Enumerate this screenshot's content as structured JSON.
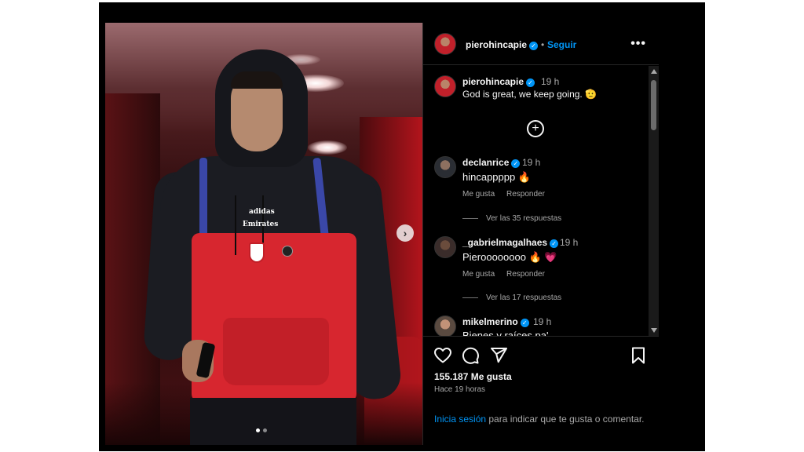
{
  "header": {
    "username": "pierohincapie",
    "verified": true,
    "separator": "•",
    "follow_label": "Seguir",
    "more_icon": "more-horizontal-icon"
  },
  "caption": {
    "username": "pierohincapie",
    "time": "19 h",
    "text": "God is great, we keep going. 🫡"
  },
  "load_more_icon": "plus-circle-icon",
  "comments": [
    {
      "username": "declanrice",
      "time": "19 h",
      "text": "hincappppp 🔥",
      "like_label": "Me gusta",
      "reply_label": "Responder",
      "view_replies": "Ver las 35 respuestas"
    },
    {
      "username": "_gabrielmagalhaes",
      "time": "19 h",
      "text": "Pieroooooooo 🔥 💗",
      "like_label": "Me gusta",
      "reply_label": "Responder",
      "view_replies": "Ver las 17 respuestas"
    },
    {
      "username": "mikelmerino",
      "time": "19 h",
      "text": "Bienes y raíces pa'"
    }
  ],
  "photo_text": {
    "brand": "adidas",
    "sponsor": "Emirates"
  },
  "footer": {
    "like_icon": "heart-icon",
    "comment_icon": "comment-icon",
    "share_icon": "send-icon",
    "save_icon": "bookmark-icon",
    "likes": "155.187 Me gusta",
    "posted": "Hace 19 horas",
    "login_link": "Inicia sesión",
    "login_text": " para indicar que te gusta o comentar."
  },
  "carousel": {
    "next_icon": "chevron-right-icon",
    "current": 1,
    "total": 2
  },
  "colors": {
    "background": "#000000",
    "accent": "#0095f6",
    "secondary_text": "#a8a8a8",
    "jersey_red": "#d7262f"
  }
}
